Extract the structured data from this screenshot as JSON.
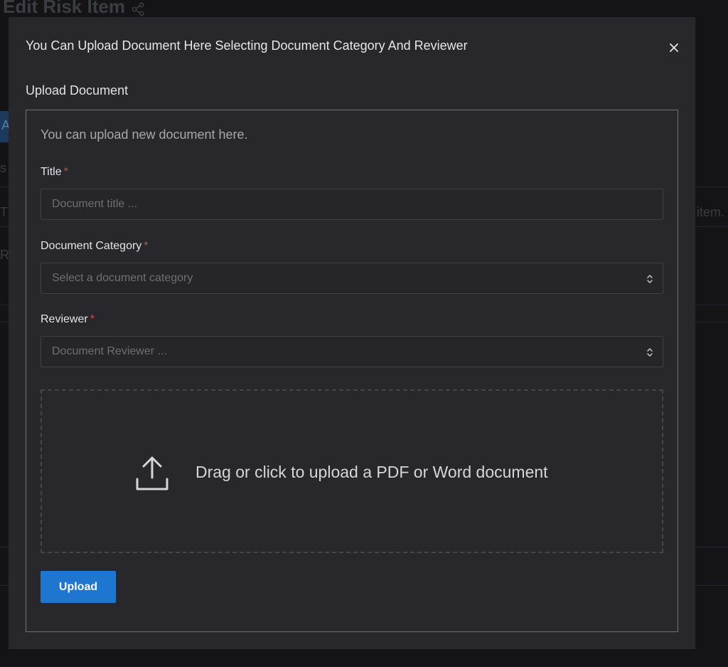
{
  "background": {
    "page_title": "Edit Risk Item",
    "fragments": [
      "A",
      "s",
      "T",
      "R",
      "item."
    ]
  },
  "modal": {
    "title": "You Can Upload Document Here Selecting Document Category And Reviewer",
    "close_icon": "close-icon",
    "section_title": "Upload Document",
    "intro": "You can upload new document here.",
    "fields": {
      "title": {
        "label": "Title",
        "required_mark": "*",
        "value": "",
        "placeholder": "Document title ..."
      },
      "category": {
        "label": "Document Category",
        "required_mark": "*",
        "placeholder": "Select a document category"
      },
      "reviewer": {
        "label": "Reviewer",
        "required_mark": "*",
        "placeholder": "Document Reviewer ..."
      }
    },
    "dropzone": {
      "icon": "upload-icon",
      "text": "Drag or click to upload a PDF or Word document"
    },
    "upload_label": "Upload"
  },
  "colors": {
    "accent": "#1e76d0",
    "required": "#d24a4a",
    "modal_bg": "#28282c",
    "page_bg": "#141416"
  }
}
